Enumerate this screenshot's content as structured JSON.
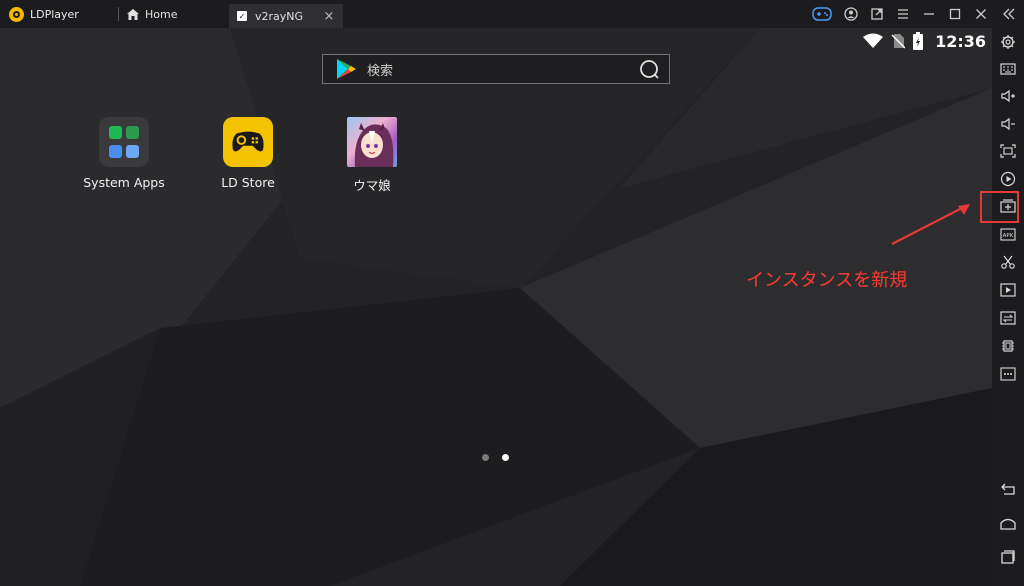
{
  "titlebar": {
    "app_name": "LDPlayer",
    "tabs": [
      {
        "label": "Home",
        "active": false
      },
      {
        "label": "v2rayNG",
        "active": true,
        "close": "×"
      }
    ]
  },
  "statusbar": {
    "time": "12:36"
  },
  "search": {
    "placeholder": "検索"
  },
  "apps": [
    {
      "label": "System Apps",
      "icon": "folder-icon"
    },
    {
      "label": "LD Store",
      "icon": "gamepad-icon"
    },
    {
      "label": "ウマ娘",
      "icon": "uma-musume-icon"
    }
  ],
  "pager": {
    "pages": 2,
    "current": 2
  },
  "toolbar": {
    "buttons": [
      "settings-icon",
      "keyboard-icon",
      "volume-up-icon",
      "volume-down-icon",
      "fullscreen-icon",
      "record-icon",
      "new-instance-icon",
      "apk-icon",
      "scissors-icon",
      "video-icon",
      "sync-icon",
      "cpu-icon",
      "more-icon",
      "back-icon",
      "home-icon",
      "recents-icon"
    ]
  },
  "annotation": {
    "text": "インスタンスを新規"
  },
  "colors": {
    "accent": "#e53935",
    "brand": "#f5b800",
    "annotation": "#ff3b30"
  }
}
